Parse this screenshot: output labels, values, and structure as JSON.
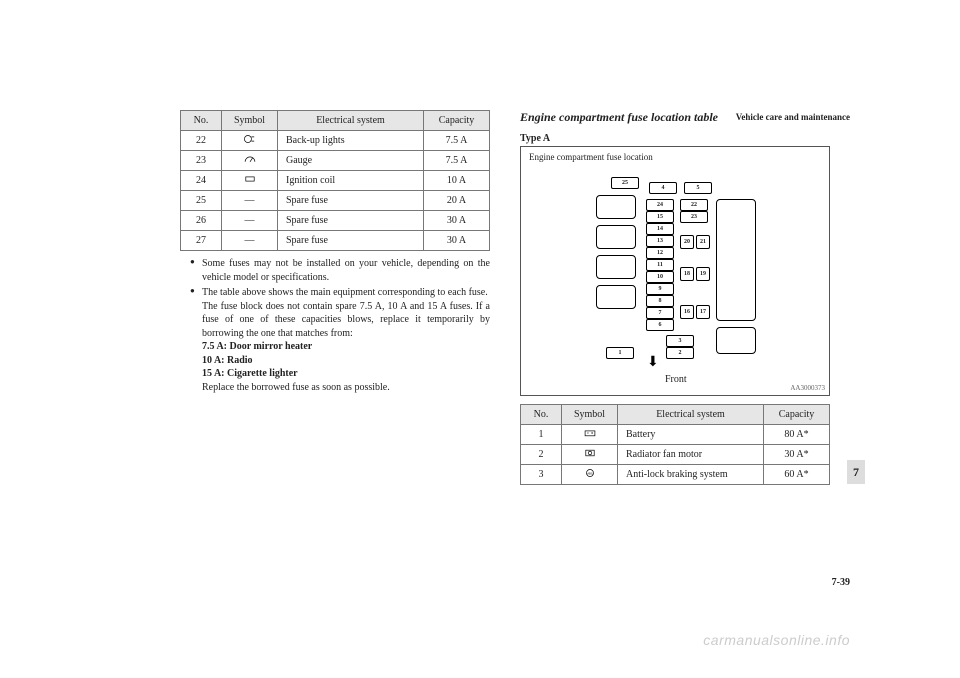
{
  "header": {
    "section": "Vehicle care and maintenance"
  },
  "left_table": {
    "headers": [
      "No.",
      "Symbol",
      "Electrical system",
      "Capacity"
    ],
    "rows": [
      {
        "no": "22",
        "symbol": "backup-light-icon",
        "system": "Back-up lights",
        "cap": "7.5 A"
      },
      {
        "no": "23",
        "symbol": "gauge-icon",
        "system": "Gauge",
        "cap": "7.5 A"
      },
      {
        "no": "24",
        "symbol": "coil-icon",
        "system": "Ignition coil",
        "cap": "10 A"
      },
      {
        "no": "25",
        "symbol": "—",
        "system": "Spare fuse",
        "cap": "20 A"
      },
      {
        "no": "26",
        "symbol": "—",
        "system": "Spare fuse",
        "cap": "30 A"
      },
      {
        "no": "27",
        "symbol": "—",
        "system": "Spare fuse",
        "cap": "30 A"
      }
    ]
  },
  "notes": {
    "n1": "Some fuses may not be installed on your vehicle, depending on the vehicle model or specifications.",
    "n2a": "The table above shows the main equipment corresponding to each fuse.",
    "n2b": "The fuse block does not contain spare 7.5 A, 10 A and 15 A fuses. If a fuse of one of these capacities blows, replace it temporarily by borrowing the one that matches from:",
    "b1": "7.5 A: Door mirror heater",
    "b2": "10 A: Radio",
    "b3": "15 A: Cigarette lighter",
    "n2c": "Replace the borrowed fuse as soon as possible."
  },
  "right": {
    "title": "Engine compartment fuse location table",
    "type": "Type A",
    "figure": {
      "caption": "Engine compartment fuse location",
      "front": "Front",
      "code": "AA3000373",
      "labels": [
        "1",
        "2",
        "3",
        "4",
        "5",
        "6",
        "7",
        "8",
        "9",
        "10",
        "11",
        "12",
        "13",
        "14",
        "15",
        "16",
        "17",
        "18",
        "19",
        "20",
        "21",
        "22",
        "23",
        "24",
        "25"
      ]
    }
  },
  "right_table": {
    "headers": [
      "No.",
      "Symbol",
      "Electrical system",
      "Capacity"
    ],
    "rows": [
      {
        "no": "1",
        "symbol": "battery-icon",
        "system": "Battery",
        "cap": "80 A*"
      },
      {
        "no": "2",
        "symbol": "fan-icon",
        "system": "Radiator fan motor",
        "cap": "30 A*"
      },
      {
        "no": "3",
        "symbol": "abs-icon",
        "system": "Anti-lock braking system",
        "cap": "60 A*"
      }
    ]
  },
  "page": {
    "tab": "7",
    "num": "7-39"
  },
  "watermark": "carmanualsonline.info"
}
